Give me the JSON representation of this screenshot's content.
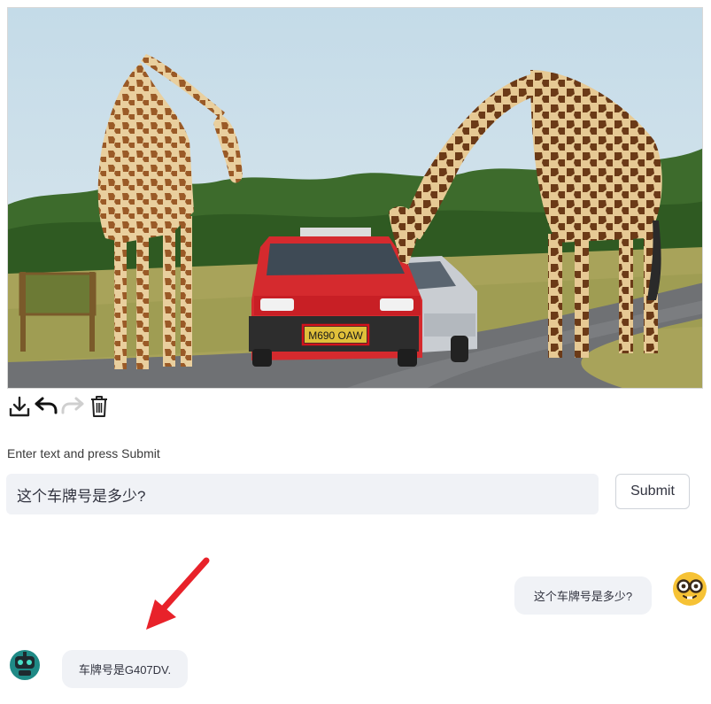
{
  "image": {
    "alt_icon": "photo-giraffes-car",
    "plate_text": "M690 OAW"
  },
  "toolbar": {
    "download_icon": "download-icon",
    "undo_icon": "undo-icon",
    "redo_icon": "redo-icon",
    "delete_icon": "trash-icon"
  },
  "input": {
    "label": "Enter text and press Submit",
    "value": "这个车牌号是多少?"
  },
  "submit": {
    "label": "Submit"
  },
  "chat": {
    "user_message": "这个车牌号是多少?",
    "bot_message": "车牌号是G407DV."
  },
  "colors": {
    "accent_arrow": "#e8222a",
    "bubble_bg": "#f0f2f6",
    "input_bg": "#f0f2f6"
  }
}
